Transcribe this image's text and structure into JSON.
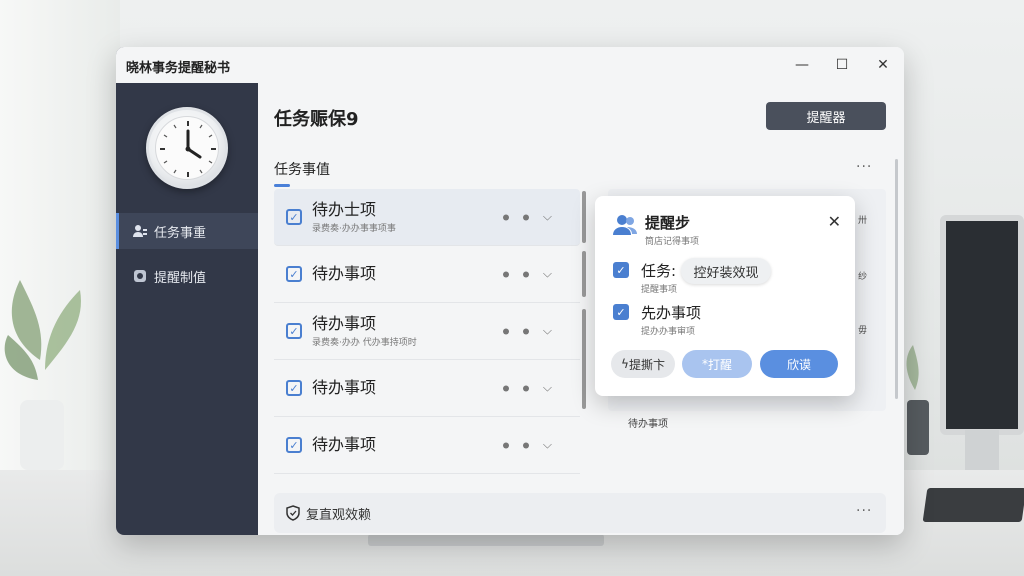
{
  "app": {
    "title": "晓林事务提醒秘书"
  },
  "window_controls": {
    "minimize": "—",
    "maximize": "☐",
    "close": "✕"
  },
  "sidebar": {
    "items": [
      {
        "label": "任务事重"
      },
      {
        "label": "提醒制值"
      }
    ]
  },
  "main": {
    "page_title": "任务赈保9",
    "remind_button": "提醒器",
    "section_title": "任务事值",
    "more": "···",
    "tasks": [
      {
        "title": "待办士项",
        "subtitle": "录费奏·办办事事项事"
      },
      {
        "title": "待办事项",
        "subtitle": ""
      },
      {
        "title": "待办事项",
        "subtitle": "录费奏·办办 代办事持项时"
      },
      {
        "title": "待办事项",
        "subtitle": ""
      },
      {
        "title": "待办事项",
        "subtitle": ""
      }
    ],
    "right_snippets": [
      "卅",
      "纱",
      "毋"
    ],
    "right_bottom": "待办事项",
    "footer_label": "复直观效赖"
  },
  "popup": {
    "title": "提醒步",
    "subtitle": "筒店记得事项",
    "close": "✕",
    "rows": [
      {
        "title": "任务:",
        "subtitle": "提醒事项"
      },
      {
        "title": "先办事项",
        "subtitle": "提办办事审项"
      }
    ],
    "tip": "控好装效现",
    "buttons": [
      {
        "label": "提撕卞"
      },
      {
        "label": "打醒"
      },
      {
        "label": "欣谟"
      }
    ],
    "button_icons": {
      "first": "ϟ",
      "second": "*"
    }
  },
  "colors": {
    "accent": "#5a8fe0",
    "sidebar": "#323848",
    "dark_button": "#4a505c"
  }
}
